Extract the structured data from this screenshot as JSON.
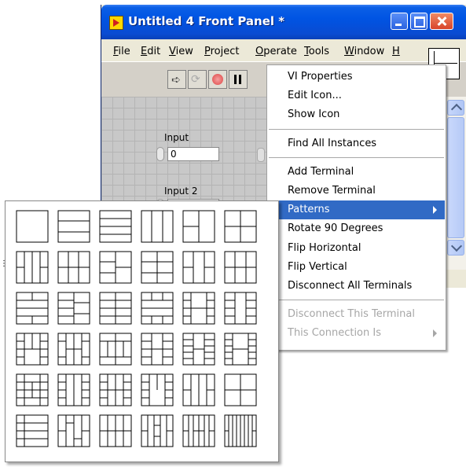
{
  "window": {
    "title": "Untitled 4 Front Panel *",
    "menu": [
      {
        "label": "File",
        "mnemonic": "F",
        "rest": "ile"
      },
      {
        "label": "Edit",
        "mnemonic": "E",
        "rest": "dit"
      },
      {
        "label": "View",
        "mnemonic": "V",
        "rest": "iew"
      },
      {
        "label": "Project",
        "mnemonic": "P",
        "rest": "roject"
      },
      {
        "label": "Operate",
        "mnemonic": "O",
        "rest": "perate"
      },
      {
        "label": "Tools",
        "mnemonic": "T",
        "rest": "ools"
      },
      {
        "label": "Window",
        "mnemonic": "W",
        "rest": "indow"
      },
      {
        "label": "H",
        "mnemonic": "H",
        "rest": ""
      }
    ],
    "toolbar_icons": [
      "run-arrow-icon",
      "run-continuously-icon",
      "abort-icon",
      "pause-icon"
    ],
    "controls": [
      {
        "label": "Input",
        "value": "0"
      },
      {
        "label": "Input 2",
        "value": ""
      }
    ]
  },
  "context_menu": {
    "groups": [
      [
        "VI Properties",
        "Edit Icon...",
        "Show Icon"
      ],
      [
        "Find All Instances"
      ],
      [
        "Add Terminal",
        "Remove Terminal",
        "Patterns",
        "Rotate 90 Degrees",
        "Flip Horizontal",
        "Flip Vertical",
        "Disconnect All Terminals"
      ],
      [
        "Disconnect This Terminal",
        "This Connection Is"
      ]
    ],
    "highlighted": "Patterns",
    "disabled": [
      "Disconnect This Terminal",
      "This Connection Is"
    ],
    "submenu_items": [
      "Patterns",
      "This Connection Is"
    ]
  },
  "patterns_palette": {
    "rows": 6,
    "columns": 6,
    "pattern_count": 36
  },
  "colors": {
    "title_bar": "#0054e3",
    "menu_highlight": "#316ac5",
    "disabled_text": "#a6a6a6",
    "panel_grid": "#c8c8c8"
  }
}
